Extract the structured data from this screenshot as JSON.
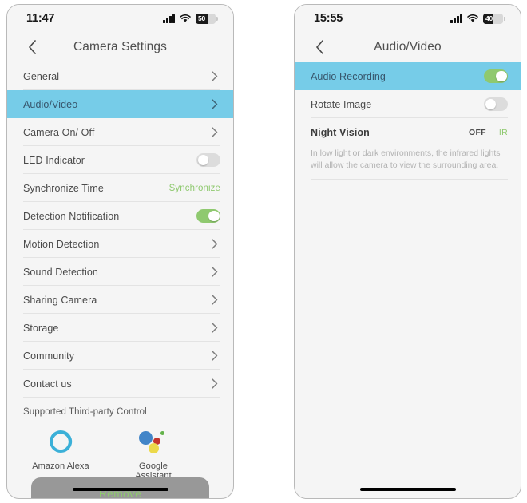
{
  "theme": {
    "accent_green": "#8FC96F",
    "highlight_blue": "#76CCE8",
    "background": "#F5F5F5",
    "divider": "#E3E3E3",
    "text_primary": "#4A4A4A",
    "text_muted": "#B3B3B3",
    "remove_button_bg": "#989898"
  },
  "screens": [
    {
      "id": "camera-settings",
      "status_bar": {
        "time": "11:47",
        "battery_level": "50",
        "signal_icon": "cellular-signal-icon",
        "wifi_icon": "wifi-icon",
        "battery_icon": "battery-icon"
      },
      "nav": {
        "back_icon": "back-chevron-icon",
        "title": "Camera Settings"
      },
      "rows": [
        {
          "label": "General",
          "type": "chevron",
          "highlight": false
        },
        {
          "label": "Audio/Video",
          "type": "chevron",
          "highlight": true
        },
        {
          "label": "Camera On/ Off",
          "type": "chevron",
          "highlight": false
        },
        {
          "label": "LED Indicator",
          "type": "toggle",
          "toggle_on": false
        },
        {
          "label": "Synchronize Time",
          "type": "action",
          "action_label": "Synchronize"
        },
        {
          "label": "Detection Notification",
          "type": "toggle",
          "toggle_on": true
        },
        {
          "label": "Motion Detection",
          "type": "chevron",
          "highlight": false
        },
        {
          "label": "Sound Detection",
          "type": "chevron",
          "highlight": false
        },
        {
          "label": "Sharing Camera",
          "type": "chevron",
          "highlight": false
        },
        {
          "label": "Storage",
          "type": "chevron",
          "highlight": false
        },
        {
          "label": "Community",
          "type": "chevron",
          "highlight": false
        },
        {
          "label": "Contact us",
          "type": "chevron",
          "highlight": false
        }
      ],
      "third_party": {
        "title": "Supported Third-party Control",
        "items": [
          {
            "name": "Amazon Alexa",
            "icon": "amazon-alexa-icon"
          },
          {
            "name": "Google Assistant",
            "icon": "google-assistant-icon"
          }
        ]
      },
      "remove_button": {
        "label": "Remove"
      }
    },
    {
      "id": "audio-video",
      "status_bar": {
        "time": "15:55",
        "battery_level": "40",
        "signal_icon": "cellular-signal-icon",
        "wifi_icon": "wifi-icon",
        "battery_icon": "battery-icon"
      },
      "nav": {
        "back_icon": "back-chevron-icon",
        "title": "Audio/Video"
      },
      "rows": [
        {
          "label": "Audio Recording",
          "type": "toggle",
          "toggle_on": true,
          "highlight": true
        },
        {
          "label": "Rotate Image",
          "type": "toggle",
          "toggle_on": false,
          "highlight": false
        }
      ],
      "night_vision": {
        "label": "Night Vision",
        "options": [
          {
            "label": "OFF",
            "selected": false
          },
          {
            "label": "IR",
            "selected": true
          }
        ],
        "description": "In low light or dark environments, the infrared lights will allow the camera to view the surrounding area."
      }
    }
  ]
}
